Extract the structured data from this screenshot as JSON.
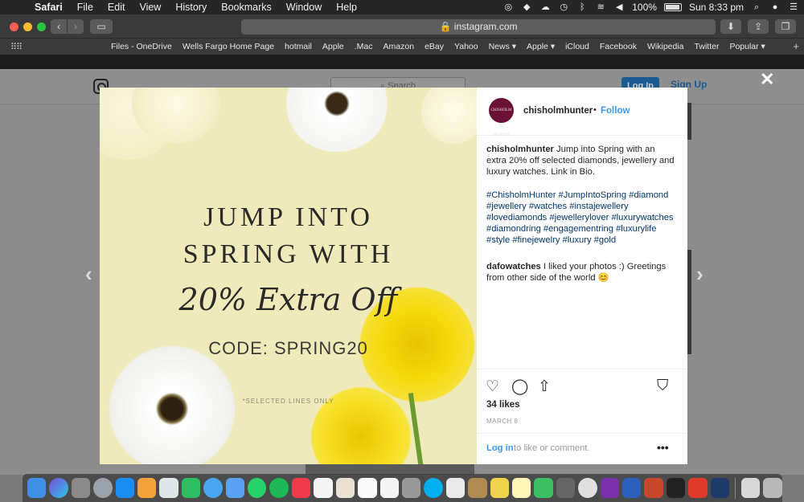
{
  "menubar": {
    "app": "Safari",
    "items": [
      "File",
      "Edit",
      "View",
      "History",
      "Bookmarks",
      "Window",
      "Help"
    ],
    "battery_percent": "100%",
    "clock": "Sun 8:33 pm"
  },
  "browser": {
    "url": "instagram.com",
    "favorites": [
      "Files - OneDrive",
      "Wells Fargo Home Page",
      "hotmail",
      "Apple",
      ".Mac",
      "Amazon",
      "eBay",
      "Yahoo",
      "News ▾",
      "Apple ▾",
      "iCloud",
      "Facebook",
      "Wikipedia",
      "Twitter",
      "Popular ▾"
    ]
  },
  "ig_header": {
    "search_placeholder": "Search",
    "login_label": "Log In",
    "signup_label": "Sign Up"
  },
  "post": {
    "image": {
      "line1": "JUMP INTO",
      "line2": "SPRING WITH",
      "line3": "20% Extra Off",
      "code": "CODE: SPRING20",
      "fineprint": "*SELECTED LINES ONLY"
    },
    "avatar_text": "CHISHOLM HUNTER",
    "username": "chisholmhunter",
    "follow_label": "Follow",
    "caption_user": "chisholmhunter",
    "caption_text": "Jump into Spring with an extra 20% off selected diamonds, jewellery and luxury watches. Link in Bio.",
    "hashtags": "#ChisholmHunter #JumpIntoSpring #diamond #jewellery #watches #instajewellery #lovediamonds #jewellerylover #luxurywatches #diamondring #engagementring #luxurylife #style #finejewelry #luxury #gold",
    "comment_user": "dafowatches",
    "comment_text": "I liked your photos :) Greetings from other side of the world 😊",
    "likes": "34 likes",
    "date": "MARCH 8",
    "login_link": "Log in",
    "login_rest": "to like or comment."
  },
  "colors": {
    "follow_blue": "#3897f0",
    "hashtag_blue": "#003569",
    "image_bg": "#efeaba"
  }
}
